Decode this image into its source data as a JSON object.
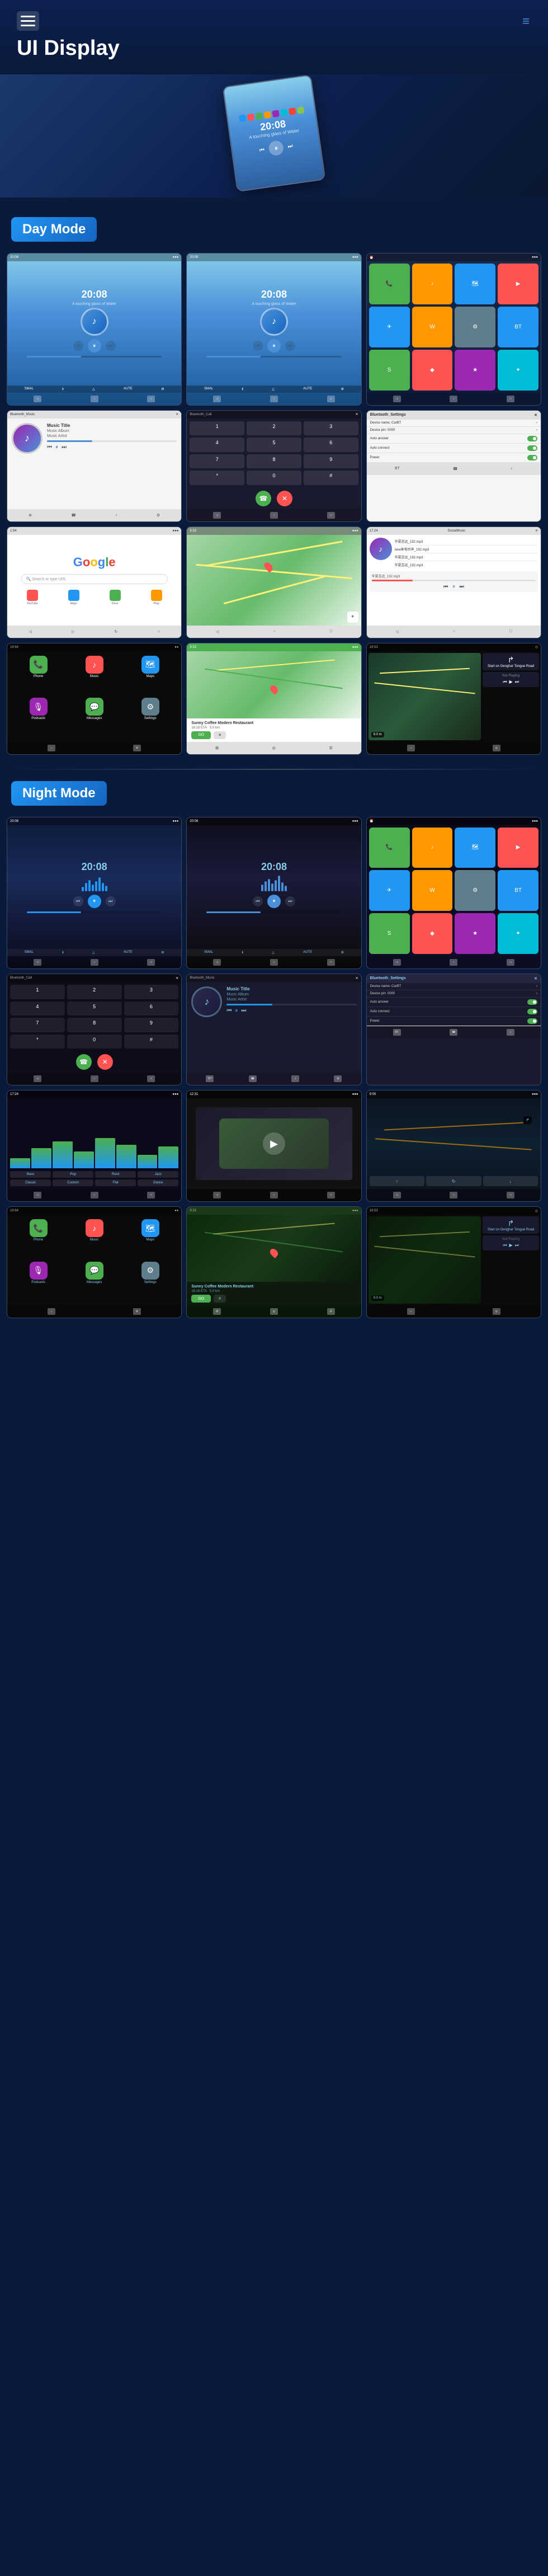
{
  "header": {
    "title": "UI Display",
    "menu_icon": "☰",
    "nav_dots": "···"
  },
  "day_mode": {
    "label": "Day Mode",
    "screens": [
      {
        "id": "day-music-1",
        "type": "music",
        "time": "20:08",
        "subtitle": "A touching glass of Water"
      },
      {
        "id": "day-music-2",
        "type": "music",
        "time": "20:08",
        "subtitle": "A touching glass of Water"
      },
      {
        "id": "day-apps",
        "type": "apps"
      },
      {
        "id": "day-bt-music",
        "type": "bluetooth_music",
        "title": "Bluetooth_Music",
        "track": "Music Title",
        "artist": "Music Album / Music Artist"
      },
      {
        "id": "day-bt-call",
        "type": "bluetooth_call",
        "title": "Bluetooth_Call"
      },
      {
        "id": "day-bt-settings",
        "type": "bluetooth_settings",
        "title": "Bluetooth_Settings",
        "items": [
          "Device name: CarBT",
          "Device pin: 0000",
          "Auto answer",
          "Auto connect",
          "Power"
        ]
      },
      {
        "id": "day-google",
        "type": "google"
      },
      {
        "id": "day-map",
        "type": "map"
      },
      {
        "id": "day-social-music",
        "type": "social_music"
      },
      {
        "id": "day-carplay-1",
        "type": "carplay_apps"
      },
      {
        "id": "day-carplay-nav",
        "type": "carplay_nav",
        "title": "Sunny Coffee Modern Restaurant",
        "eta": "18:18 ETA",
        "distance": "5.0 km",
        "go_label": "GO"
      },
      {
        "id": "day-carplay-map",
        "type": "carplay_map",
        "distance": "9.0 m",
        "label": "Start on Genghar Tongue Road",
        "music_label": "Not Playing"
      }
    ]
  },
  "night_mode": {
    "label": "Night Mode",
    "screens": [
      {
        "id": "night-music-1",
        "type": "music_night",
        "time": "20:08",
        "subtitle": ""
      },
      {
        "id": "night-music-2",
        "type": "music_night",
        "time": "20:08",
        "subtitle": ""
      },
      {
        "id": "night-apps",
        "type": "apps_night"
      },
      {
        "id": "night-bt-call",
        "type": "bluetooth_call_night",
        "title": "Bluetooth_Call"
      },
      {
        "id": "night-bt-music",
        "type": "bluetooth_music_night",
        "title": "Bluetooth_Music",
        "track": "Music Title",
        "artist": "Music Album / Music Artist"
      },
      {
        "id": "night-bt-settings",
        "type": "bluetooth_settings_night",
        "title": "Bluetooth_Settings",
        "items": [
          "Device name: CarBT",
          "Device pin: 0000",
          "Auto answer",
          "Auto connect",
          "Power"
        ]
      },
      {
        "id": "night-eq",
        "type": "equalizer"
      },
      {
        "id": "night-video",
        "type": "video"
      },
      {
        "id": "night-nav",
        "type": "navigation_night"
      },
      {
        "id": "night-carplay-1",
        "type": "carplay_apps_night"
      },
      {
        "id": "night-carplay-nav",
        "type": "carplay_nav_night",
        "title": "Sunny Coffee Modern Restaurant",
        "eta": "18:18 ETA",
        "distance": "5.0 km",
        "go_label": "GO"
      },
      {
        "id": "night-carplay-map",
        "type": "carplay_map_night",
        "distance": "9.0 m",
        "label": "Start on Genghar Tongue Road",
        "music_label": "Not Playing"
      }
    ]
  },
  "app_colors": {
    "phone": "#4CAF50",
    "messages": "#4CAF50",
    "maps": "#4CAF50",
    "music": "#FF5252",
    "settings": "#9E9E9E",
    "safari": "#2196F3",
    "podcasts": "#9C27B0",
    "photos": "#FF9800",
    "bt": "#2196F3",
    "waze": "#FF9800",
    "spotify": "#4CAF50",
    "youtube": "#FF5252",
    "telegram": "#2196F3",
    "app1": "#FF5252",
    "app2": "#4CAF50",
    "app3": "#2196F3",
    "app4": "#FF9800"
  }
}
